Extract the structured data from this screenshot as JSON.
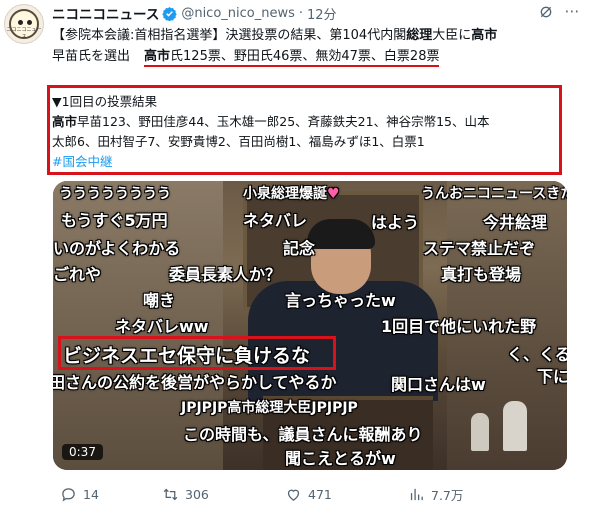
{
  "post": {
    "account_name": "ニコニコニュース",
    "handle": "@nico_nico_news",
    "separator": "·",
    "time": "12分",
    "avatar_caption": "ニコニコニュース",
    "text_line1": "【参院本会議:首相指名選挙】決選投票の結果、第104代内閣総理大臣に高市",
    "text_line2_prefix": "早苗氏を選出",
    "text_line2_result": "高市氏125票、野田氏46票、無効47票、白票28票",
    "result_heading": "▼1回目の投票結果",
    "result_line1": "高市早苗123、野田佳彦44、玉木雄一郎25、斉藤鉄夫21、神谷宗幣15、山本",
    "result_line2": "太郎6、田村智子7、安野貴博2、百田尚樹1、福島みずほ1、白票1",
    "hashtag": "#国会中継"
  },
  "media": {
    "duration": "0:37",
    "comments": [
      "うううううううう",
      "小泉総理爆誕",
      "うんおニコニュースきた",
      "もうすぐ5万円",
      "ネタバレ",
      "はよう",
      "今井絵理",
      "いのがよくわかる",
      "記念",
      "ステマ禁止だぞ",
      "ごれや",
      "委員長素人か？",
      "真打も登場",
      "嘲き",
      "言っちゃったw",
      "ネタバレww",
      "1回目で他にいれた野",
      "ビジネスエセ保守に負けるな",
      "く、くる",
      "田さんの公約を後営がやらかしてやるか",
      "関口さんはw",
      "下に",
      "JPJPJP高市総理大臣JPJPJP",
      "この時間も、議員さんに報酬あり",
      "聞こえとるがw"
    ]
  },
  "actions": {
    "replies": "14",
    "reposts": "306",
    "likes": "471",
    "views": "7.7万"
  },
  "colors": {
    "highlight_red": "#d8121a",
    "link_blue": "#1d9bf0",
    "verified_blue": "#1d9bf0",
    "secondary_text": "#536471"
  },
  "icons": [
    "avatar",
    "verified-badge-icon",
    "grok-icon",
    "more-icon",
    "reply-icon",
    "repost-icon",
    "like-icon",
    "views-icon"
  ]
}
